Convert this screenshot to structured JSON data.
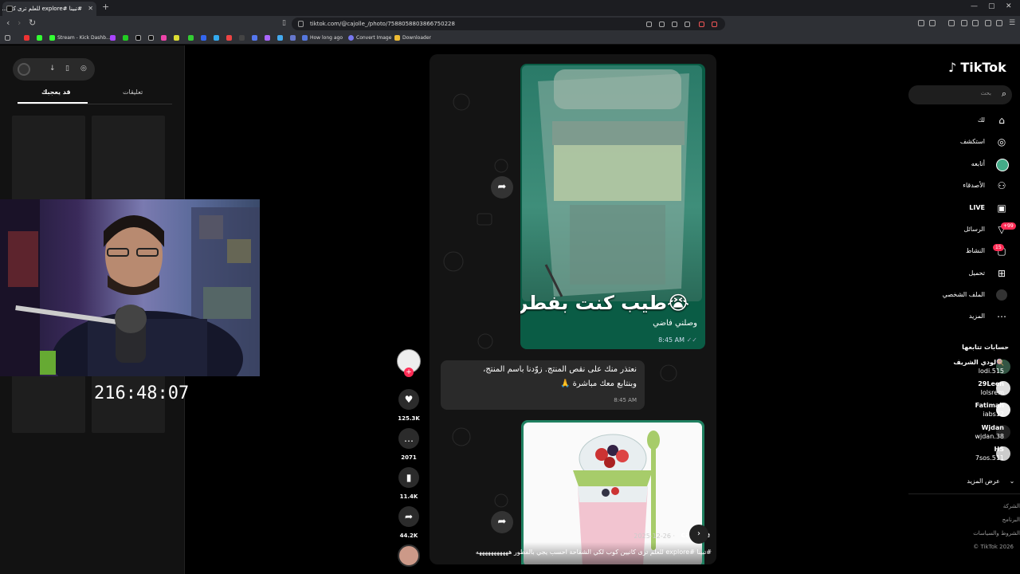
{
  "browser": {
    "tab_title": "#تبينا #explore للعلم ترى كان...",
    "url": "tiktok.com/@cajolle_/photo/7588058803866750228",
    "update_badge": "!",
    "bookmarks": [
      "Stream - Kick Dashb...",
      "How long ago",
      "Convert Image",
      "Downloader"
    ]
  },
  "left_panel": {
    "tabs": [
      "تعليقات",
      "قد يعجبك"
    ],
    "timer": "216:48:07"
  },
  "video": {
    "bubble1_caption": "طيب كنت بفطر😭",
    "bubble1_sub": "وصلني فاضي",
    "bubble1_time": "8:45 AM",
    "bubble2_line1": "نعتذر منك على نقص المنتج. زوّدنا باسم المنتج،",
    "bubble2_line2": "وبنتابع معك مباشرة 🙏",
    "bubble2_time": "8:45 AM",
    "author": "cajolle",
    "date": "2025-12-26 ·",
    "description": "#تبينا #explore للعلم ترى كانيين كوب لكي الشقاحة احسب يجي بالفطور هههههههههههه"
  },
  "actions": {
    "likes": "125.3K",
    "comments": "2071",
    "saves": "11.4K",
    "shares": "44.2K"
  },
  "sidebar": {
    "logo": "TikTok",
    "search_placeholder": "بحث",
    "menu": [
      "لك",
      "استكشف",
      "أتابعه",
      "الأصدقاء",
      "LIVE",
      "الرسائل",
      "النشاط",
      "تحميل",
      "الملف الشخصي",
      "المزيد"
    ],
    "messages_badge": "+99",
    "activity_badge": "15",
    "following_title": "حسابات تتابعها",
    "following": [
      {
        "name": "لودي الشريف🍭",
        "handle": "lodi.515"
      },
      {
        "name": "29Leen",
        "handle": "lolsrem"
      },
      {
        "name": "Fatimah",
        "handle": "iabs12"
      },
      {
        "name": "Wjdan",
        "handle": "wjdan.38"
      },
      {
        "name": "HS",
        "handle": "7sos.511"
      }
    ],
    "see_more": "عرض المزيد",
    "footer": [
      "الشركة",
      "البرنامج",
      "الشروط والسياسات",
      "© TikTok 2026"
    ]
  },
  "colors": {
    "tiktok_red": "#fe2c55",
    "whatsapp_green": "#0a5c45"
  }
}
